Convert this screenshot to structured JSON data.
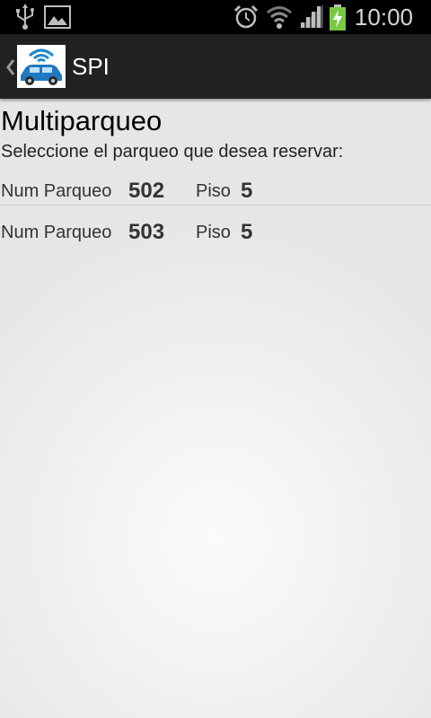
{
  "status_bar": {
    "time": "10:00",
    "icons": [
      "usb-icon",
      "image-icon",
      "alarm-icon",
      "wifi-icon",
      "signal-icon",
      "battery-charging-icon"
    ],
    "battery_color": "#7ac943"
  },
  "action_bar": {
    "title": "SPI",
    "background": "#212121"
  },
  "page": {
    "title": "Multiparqueo",
    "instruction": "Seleccione el parqueo que desea reservar:"
  },
  "parkings": [
    {
      "num_label": "Num Parqueo",
      "num": "502",
      "floor_label": "Piso",
      "floor": "5"
    },
    {
      "num_label": "Num Parqueo",
      "num": "503",
      "floor_label": "Piso",
      "floor": "5"
    }
  ]
}
